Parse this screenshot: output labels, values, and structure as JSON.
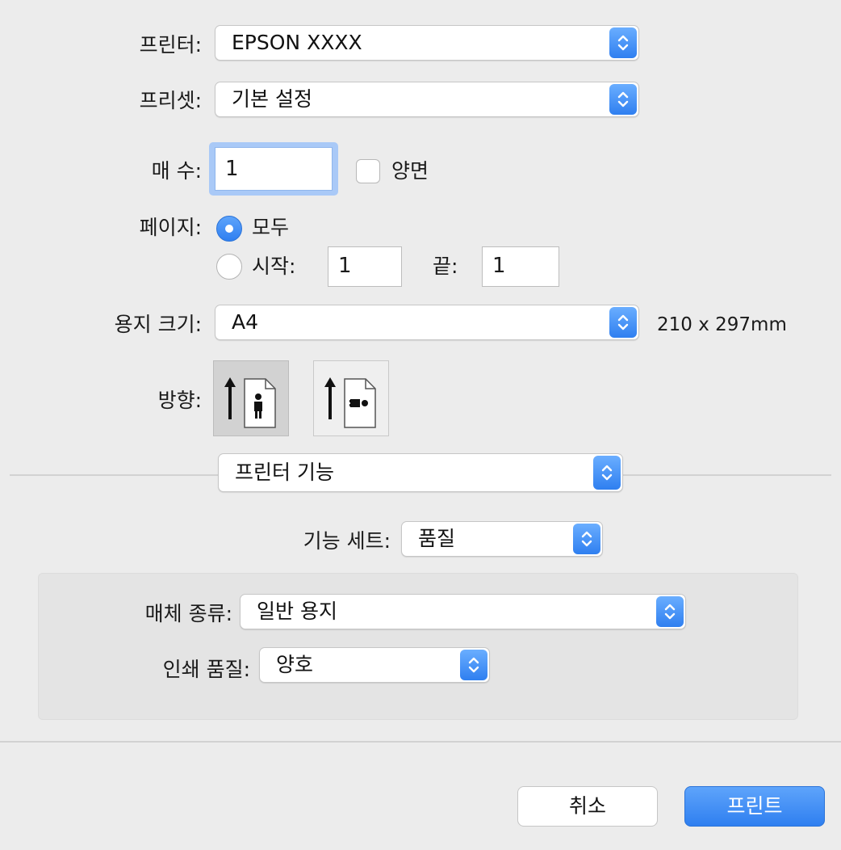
{
  "printer": {
    "label": "프린터:",
    "value": "EPSON XXXX"
  },
  "preset": {
    "label": "프리셋:",
    "value": "기본 설정"
  },
  "copies": {
    "label": "매 수:",
    "value": "1",
    "duplex_label": "양면",
    "duplex_checked": false
  },
  "pages": {
    "label": "페이지:",
    "all_label": "모두",
    "range_label": "시작:",
    "from": "1",
    "to_label": "끝:",
    "to": "1",
    "selected": "all"
  },
  "paper_size": {
    "label": "용지 크기:",
    "value": "A4",
    "dimensions": "210 x 297mm"
  },
  "orientation": {
    "label": "방향:",
    "options": [
      "portrait-icon",
      "landscape-icon"
    ],
    "selected": "portrait"
  },
  "section": {
    "value": "프린터 기능"
  },
  "feature_set": {
    "label": "기능 세트:",
    "value": "품질"
  },
  "media_type": {
    "label": "매체 종류:",
    "value": "일반 용지"
  },
  "print_quality": {
    "label": "인쇄 품질:",
    "value": "양호"
  },
  "buttons": {
    "cancel": "취소",
    "print": "프린트"
  },
  "colors": {
    "accent": "#2f7ff0",
    "background": "#ececec",
    "panel": "#e4e4e4"
  }
}
